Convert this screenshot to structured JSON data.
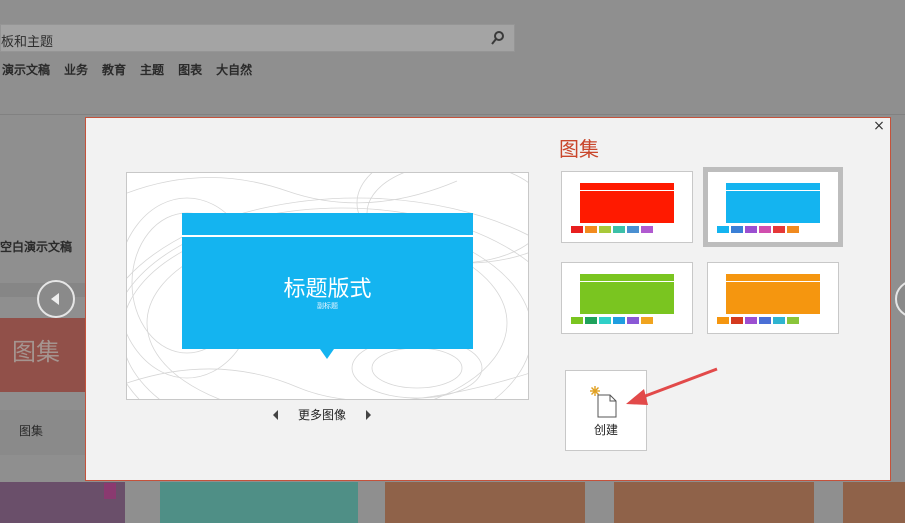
{
  "background": {
    "search_text": "板和主题",
    "categories": [
      "演示文稿",
      "业务",
      "教育",
      "主题",
      "图表",
      "大自然"
    ],
    "left_label": "空白演示文稿",
    "tile_title": "图集",
    "tile_caption": "图集"
  },
  "dialog": {
    "close_label": "×",
    "preview": {
      "title": "标题版式",
      "subtitle": "副标题"
    },
    "more_images_label": "更多图像",
    "gallery_title": "图集",
    "variants": [
      {
        "color": "#ff1a00",
        "chips": [
          "#e81f1f",
          "#f28b1f",
          "#a8c93a",
          "#3cc0a8",
          "#4a8fd1",
          "#b05ad0"
        ],
        "selected": false
      },
      {
        "color": "#14b4f0",
        "chips": [
          "#14b4f0",
          "#3a7fd6",
          "#9b4fd1",
          "#d14fae",
          "#e53838",
          "#f08a1f"
        ],
        "selected": true
      },
      {
        "color": "#7ac520",
        "chips": [
          "#7ac520",
          "#1fa25c",
          "#2fd0c8",
          "#1f9ee0",
          "#8a58d6",
          "#f0a41f"
        ],
        "selected": false
      },
      {
        "color": "#f5960f",
        "chips": [
          "#f5960f",
          "#d43a1f",
          "#9c4fd1",
          "#4a6fd6",
          "#2fb4d0",
          "#8ac53a"
        ],
        "selected": false
      }
    ],
    "create_label": "创建"
  }
}
